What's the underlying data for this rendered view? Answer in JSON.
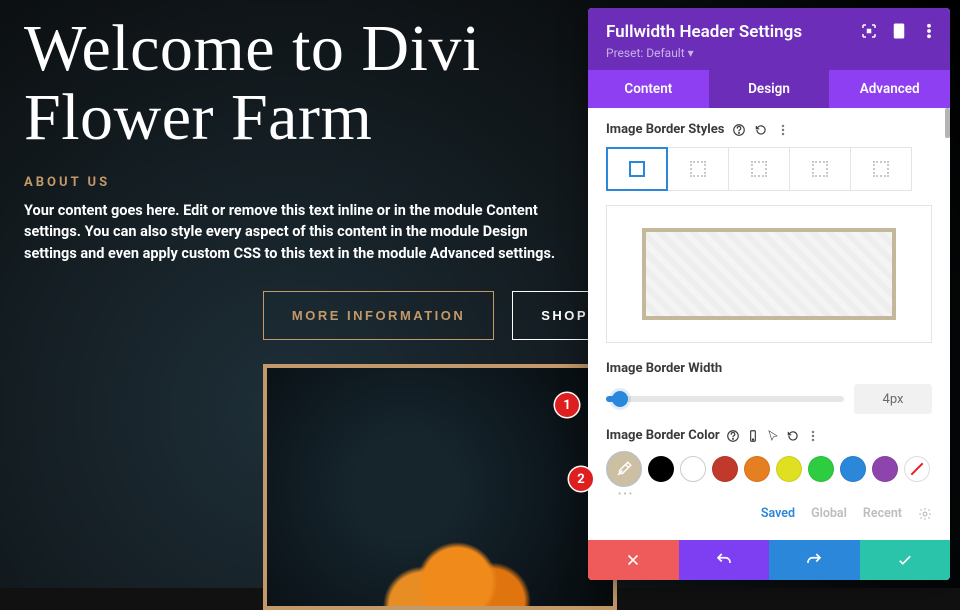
{
  "hero": {
    "headline_l1": "Welcome to Divi",
    "headline_l2": "Flower Farm",
    "subhead": "ABOUT US",
    "body": "Your content goes here. Edit or remove this text inline or in the module Content settings. You can also style every aspect of this content in the module Design settings and even apply custom CSS to this text in the module Advanced settings.",
    "btn_primary": "MORE INFORMATION",
    "btn_secondary": "SHOP"
  },
  "panel": {
    "title": "Fullwidth Header Settings",
    "preset": "Preset: Default ▾",
    "tabs": {
      "content": "Content",
      "design": "Design",
      "advanced": "Advanced",
      "active": "design"
    },
    "border_styles_label": "Image Border Styles",
    "border_width_label": "Image Border Width",
    "border_width_value": "4px",
    "border_color_label": "Image Border Color",
    "swatch_more": "•••",
    "palette_tabs": {
      "saved": "Saved",
      "global": "Global",
      "recent": "Recent"
    },
    "swatches": [
      "#cdbfa2",
      "#000000",
      "#ffffff",
      "#c0392b",
      "#e67e22",
      "#dfe022",
      "#2ecc40",
      "#2b87da",
      "#8e44ad"
    ],
    "footer": {
      "close": "close",
      "undo": "undo",
      "redo": "redo",
      "save": "save"
    }
  },
  "annotations": {
    "a1": "1",
    "a2": "2"
  }
}
